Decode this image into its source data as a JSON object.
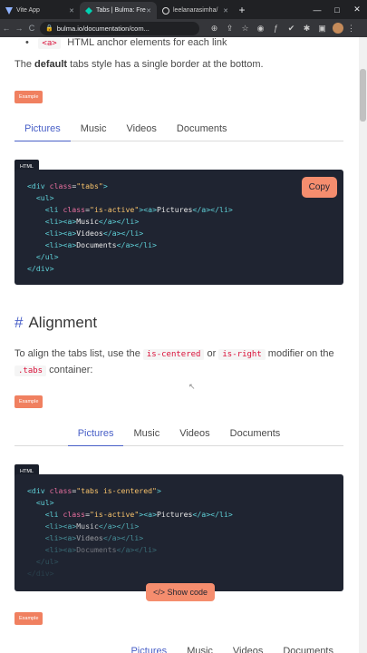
{
  "browser": {
    "tabs": [
      {
        "title": "Vite App",
        "icon": "vite-icon"
      },
      {
        "title": "Tabs | Bulma: Fre",
        "icon": "bulma-icon"
      },
      {
        "title": "leelanarasimha/",
        "icon": "github-icon"
      }
    ],
    "new_tab": "+",
    "window_controls": [
      "—",
      "□",
      "✕"
    ],
    "url": "bulma.io/documentation/com...",
    "nav": {
      "back": "←",
      "forward": "→",
      "reload": "C"
    }
  },
  "intro": {
    "bullet_code": "<a>",
    "bullet_text": "HTML anchor elements for each link",
    "default_text_pre": "The ",
    "default_text_bold": "default",
    "default_text_post": " tabs style has a single border at the bottom."
  },
  "example_label": "Example",
  "html_label": "HTML",
  "demo_tabs": [
    "Pictures",
    "Music",
    "Videos",
    "Documents"
  ],
  "code1": {
    "copy_label": "Copy",
    "lines": [
      "<div class=\"tabs\">",
      "  <ul>",
      "    <li class=\"is-active\"><a>Pictures</a></li>",
      "    <li><a>Music</a></li>",
      "    <li><a>Videos</a></li>",
      "    <li><a>Documents</a></li>",
      "  </ul>",
      "</div>"
    ]
  },
  "alignment": {
    "hash": "#",
    "title": "Alignment",
    "text_pre": "To align the tabs list, use the ",
    "code_centered": "is-centered",
    "text_or": " or ",
    "code_right": "is-right",
    "text_mid": " modifier on the",
    "code_tabs": ".tabs",
    "text_post": " container:"
  },
  "code2": {
    "show_code_label": "</> Show code",
    "lines": [
      "<div class=\"tabs is-centered\">",
      "  <ul>",
      "    <li class=\"is-active\"><a>Pictures</a></li>",
      "    <li><a>Music</a></li>",
      "    <li><a>Videos</a></li>",
      "    <li><a>Documents</a></li>",
      "  </ul>",
      "</div>"
    ]
  },
  "colors": {
    "accent": "#485fc7",
    "example_bg": "#f08060",
    "code_bg": "#1f2431"
  }
}
